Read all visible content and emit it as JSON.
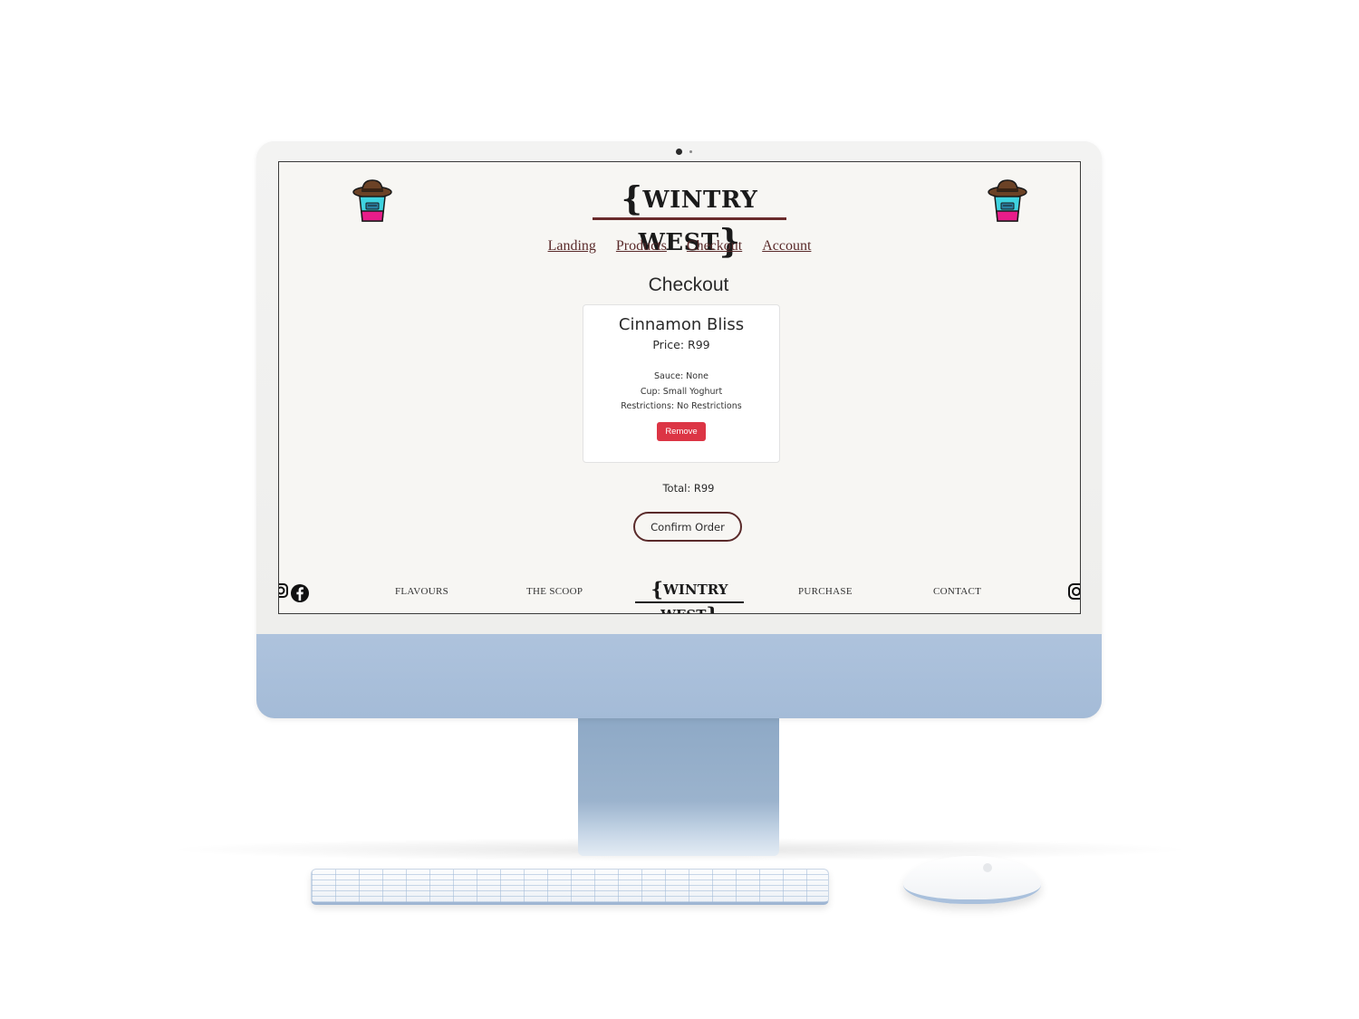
{
  "brand": {
    "name": "WINTRY WEST",
    "brace_open": "{",
    "brace_close": "}"
  },
  "nav": {
    "items": [
      "Landing",
      "Products",
      "Checkout",
      "Account"
    ]
  },
  "page": {
    "title": "Checkout"
  },
  "cart_item": {
    "name": "Cinnamon Bliss",
    "price": "Price: R99",
    "sauce": "Sauce: None",
    "cup": "Cup: Small Yoghurt",
    "restrictions": "Restrictions: No Restrictions",
    "remove_label": "Remove"
  },
  "total": "Total: R99",
  "confirm_label": "Confirm Order",
  "footer": {
    "links": [
      "FLAVOURS",
      "THE SCOOP",
      "PURCHASE",
      "CONTACT"
    ],
    "logo": "WINTRY WEST"
  },
  "colors": {
    "accent": "#5a2a2a",
    "remove": "#dc3545",
    "screen_bg": "#f7f6f3",
    "monitor_chin": "#aec3dd"
  },
  "icons": [
    "mascot-icon",
    "instagram-icon",
    "facebook-icon"
  ]
}
